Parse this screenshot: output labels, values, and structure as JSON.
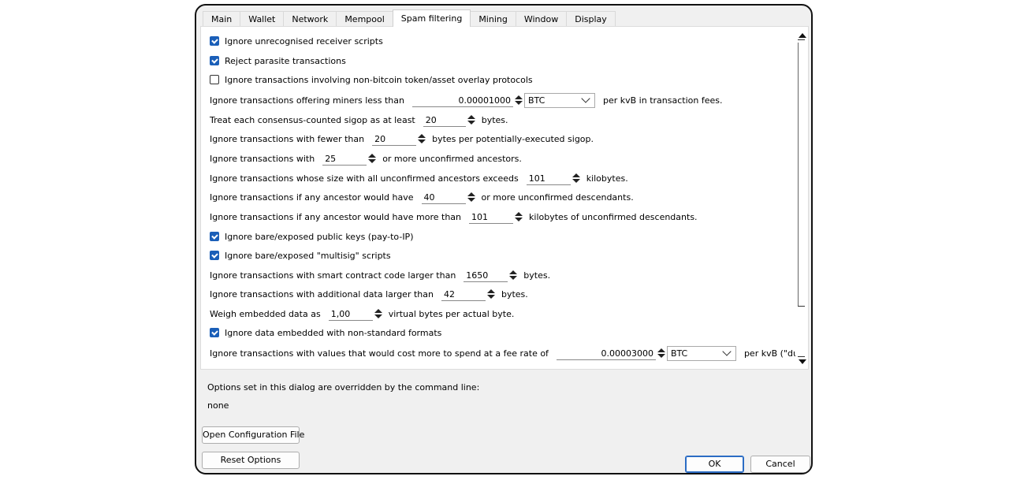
{
  "tabs": [
    "Main",
    "Wallet",
    "Network",
    "Mempool",
    "Spam filtering",
    "Mining",
    "Window",
    "Display"
  ],
  "active_tab": "Spam filtering",
  "options": {
    "ignore_unrecognised": {
      "label": "Ignore unrecognised receiver scripts",
      "checked": true
    },
    "reject_parasite": {
      "label": "Reject parasite transactions",
      "checked": true
    },
    "ignore_overlay": {
      "label": "Ignore transactions involving non-bitcoin token/asset overlay protocols",
      "checked": false
    },
    "min_fee": {
      "pre": "Ignore transactions offering miners less than",
      "value": "0.00001000",
      "unit": "BTC",
      "post": "per kvB in transaction fees."
    },
    "sigop": {
      "pre": "Treat each consensus-counted sigop as at least",
      "value": "20",
      "post": "bytes."
    },
    "bytes_per_sigop": {
      "pre": "Ignore transactions with fewer than",
      "value": "20",
      "post": "bytes per potentially-executed sigop."
    },
    "ancestors": {
      "pre": "Ignore transactions with",
      "value": "25",
      "post": "or more unconfirmed ancestors."
    },
    "ancestor_size": {
      "pre": "Ignore transactions whose size with all unconfirmed ancestors exceeds",
      "value": "101",
      "post": "kilobytes."
    },
    "descendants": {
      "pre": "Ignore transactions if any ancestor would have",
      "value": "40",
      "post": "or more unconfirmed descendants."
    },
    "descendant_size": {
      "pre": "Ignore transactions if any ancestor would have more than",
      "value": "101",
      "post": "kilobytes of unconfirmed descendants."
    },
    "bare_pubkeys": {
      "label": "Ignore bare/exposed public keys (pay-to-IP)",
      "checked": true
    },
    "bare_multisig": {
      "label": "Ignore bare/exposed \"multisig\" scripts",
      "checked": true
    },
    "smart_contract": {
      "pre": "Ignore transactions with smart contract code larger than",
      "value": "1650",
      "post": "bytes."
    },
    "additional_data": {
      "pre": "Ignore transactions with additional data larger than",
      "value": "42",
      "post": "bytes."
    },
    "weigh_data": {
      "pre": "Weigh embedded data as",
      "value": "1,00",
      "post": "virtual bytes per actual byte."
    },
    "nonstandard_data": {
      "label": "Ignore data embedded with non-standard formats",
      "checked": true
    },
    "dust": {
      "pre": "Ignore transactions with values that would cost more to spend at a fee rate of",
      "value": "0.00003000",
      "unit": "BTC",
      "post": "per kvB (\"dust\")."
    }
  },
  "override_note": "Options set in this dialog are overridden by the command line:",
  "override_value": "none",
  "buttons": {
    "open_config": "Open Configuration File",
    "reset": "Reset Options",
    "ok": "OK",
    "cancel": "Cancel"
  }
}
